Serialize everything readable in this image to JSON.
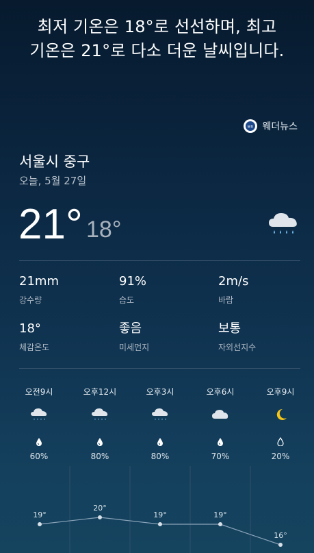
{
  "headline": {
    "line1": "최저 기온은 18°로 선선하며, 최고",
    "line2": "기온은 21°로 다소 더운 날씨입니다."
  },
  "brand": {
    "name": "웨더뉴스",
    "logo_icon": "weathernews-logo-icon"
  },
  "location": {
    "name": "서울시 중구",
    "date": "오늘, 5월 27일"
  },
  "current": {
    "high": "21°",
    "low": "18°",
    "icon": "cloud-rain-icon"
  },
  "stats": [
    {
      "value": "21mm",
      "label": "강수량"
    },
    {
      "value": "91%",
      "label": "습도"
    },
    {
      "value": "2m/s",
      "label": "바람"
    },
    {
      "value": "18°",
      "label": "체감온도"
    },
    {
      "value": "좋음",
      "label": "미세먼지"
    },
    {
      "value": "보통",
      "label": "자외선지수"
    }
  ],
  "hourly": [
    {
      "time": "오전9시",
      "icon": "cloud-rain-icon",
      "precip": "60%",
      "temp": 19,
      "temp_label": "19°"
    },
    {
      "time": "오후12시",
      "icon": "cloud-rain-icon",
      "precip": "80%",
      "temp": 20,
      "temp_label": "20°"
    },
    {
      "time": "오후3시",
      "icon": "cloud-rain-icon",
      "precip": "80%",
      "temp": 19,
      "temp_label": "19°"
    },
    {
      "time": "오후6시",
      "icon": "cloud-icon",
      "precip": "70%",
      "temp": 19,
      "temp_label": "19°"
    },
    {
      "time": "오후9시",
      "icon": "moon-icon",
      "precip": "20%",
      "temp": 16,
      "temp_label": "16°"
    }
  ],
  "colors": {
    "moon": "#f5c518",
    "cloud": "#dfe5ea",
    "rain": "#6fb7e9"
  }
}
